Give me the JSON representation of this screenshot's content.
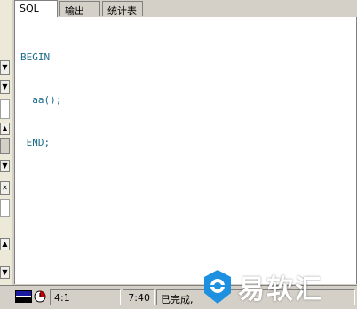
{
  "tabs": [
    {
      "label": "SQL",
      "active": true
    },
    {
      "label": "输出",
      "active": false
    },
    {
      "label": "统计表",
      "active": false
    }
  ],
  "editor": {
    "lines": [
      "BEGIN",
      "  aa();",
      " END;"
    ],
    "text_color": "#1c6b8a"
  },
  "left_panel": {
    "icons": [
      "dropdown-arrow-icon",
      "dropdown-arrow-icon",
      "scroll-up-icon",
      "scroll-down-icon",
      "close-icon",
      "scroll-up-icon",
      "scroll-down-icon"
    ]
  },
  "statusbar": {
    "position": "4:1",
    "time": "7:40",
    "status": "已完成,"
  },
  "watermark": {
    "text": "易软汇",
    "brand_color": "#1e90e0"
  }
}
